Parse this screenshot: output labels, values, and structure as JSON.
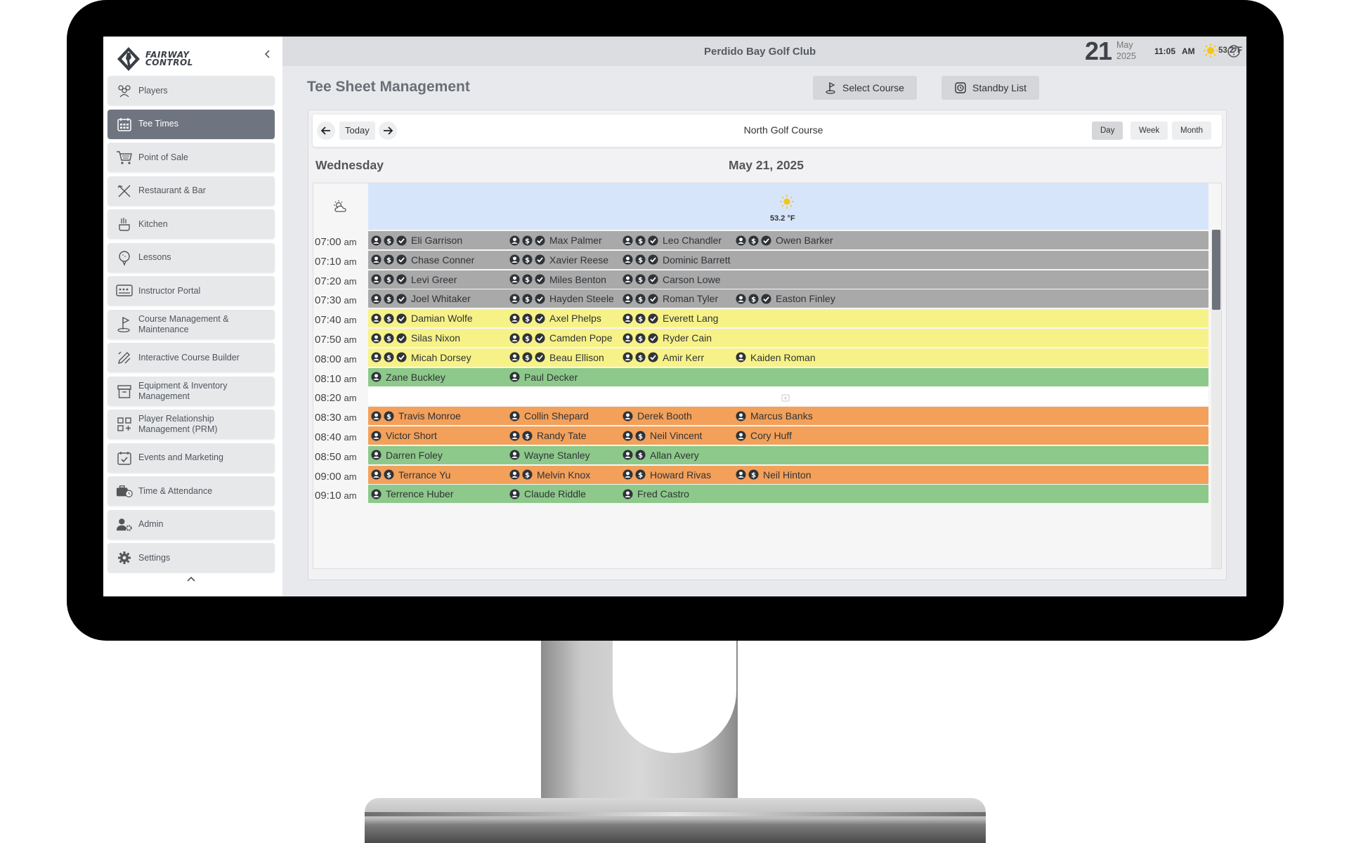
{
  "brand": {
    "logo_line1": "FAIRWAY",
    "logo_line2": "CONTROL"
  },
  "sidebar": {
    "items": [
      {
        "label": "Players",
        "icon": "players-icon",
        "active": false
      },
      {
        "label": "Tee Times",
        "icon": "calendar-grid-icon",
        "active": true
      },
      {
        "label": "Point of Sale",
        "icon": "shopping-cart-icon",
        "active": false
      },
      {
        "label": "Restaurant & Bar",
        "icon": "utensils-icon",
        "active": false
      },
      {
        "label": "Kitchen",
        "icon": "cooking-pot-icon",
        "active": false
      },
      {
        "label": "Lessons",
        "icon": "golf-ball-tee-icon",
        "active": false
      },
      {
        "label": "Instructor Portal",
        "icon": "chalkboard-icon",
        "active": false
      },
      {
        "label": "Course Management & Maintenance",
        "icon": "flag-icon",
        "active": false
      },
      {
        "label": "Interactive Course Builder",
        "icon": "pencil-ruler-icon",
        "active": false
      },
      {
        "label": "Equipment & Inventory Management",
        "icon": "archive-box-icon",
        "active": false
      },
      {
        "label": "Player Relationship Management (PRM)",
        "icon": "grid-plus-icon",
        "active": false
      },
      {
        "label": "Events and Marketing",
        "icon": "calendar-check-icon",
        "active": false
      },
      {
        "label": "Time & Attendance",
        "icon": "briefcase-clock-icon",
        "active": false
      },
      {
        "label": "Admin",
        "icon": "user-gear-icon",
        "active": false
      },
      {
        "label": "Settings",
        "icon": "gear-icon",
        "active": false
      }
    ]
  },
  "header": {
    "club_name": "Perdido Bay Golf Club",
    "day": "21",
    "month": "May",
    "year": "2025",
    "time": "11:05",
    "ampm": "AM",
    "temp": "53.2°F"
  },
  "main": {
    "title": "Tee Sheet Management",
    "select_course": "Select Course",
    "standby_list": "Standby List",
    "today": "Today",
    "course": "North Golf Course",
    "views": [
      "Day",
      "Week",
      "Month"
    ],
    "active_view": "Day",
    "weekday": "Wednesday",
    "date": "May 21, 2025",
    "weather_temp": "53.2 °F"
  },
  "tee_times": [
    {
      "time": "07:00",
      "ap": "am",
      "color": "gray",
      "players": [
        {
          "name": "Eli Garrison",
          "icons": [
            "user",
            "dollar",
            "check"
          ]
        },
        {
          "name": "Max Palmer",
          "icons": [
            "user",
            "dollar",
            "check"
          ]
        },
        {
          "name": "Leo Chandler",
          "icons": [
            "user",
            "dollar",
            "check"
          ]
        },
        {
          "name": "Owen Barker",
          "icons": [
            "user",
            "dollar",
            "check"
          ]
        }
      ]
    },
    {
      "time": "07:10",
      "ap": "am",
      "color": "gray",
      "players": [
        {
          "name": "Chase Conner",
          "icons": [
            "user",
            "dollar",
            "check"
          ]
        },
        {
          "name": "Xavier Reese",
          "icons": [
            "user",
            "dollar",
            "check"
          ]
        },
        {
          "name": "Dominic Barrett",
          "icons": [
            "user",
            "dollar",
            "check"
          ]
        }
      ]
    },
    {
      "time": "07:20",
      "ap": "am",
      "color": "gray",
      "players": [
        {
          "name": "Levi Greer",
          "icons": [
            "user",
            "dollar",
            "check"
          ]
        },
        {
          "name": "Miles Benton",
          "icons": [
            "user",
            "dollar",
            "check"
          ]
        },
        {
          "name": "Carson Lowe",
          "icons": [
            "user",
            "dollar",
            "check"
          ]
        }
      ]
    },
    {
      "time": "07:30",
      "ap": "am",
      "color": "gray",
      "players": [
        {
          "name": "Joel Whitaker",
          "icons": [
            "user",
            "dollar",
            "check"
          ]
        },
        {
          "name": "Hayden Steele",
          "icons": [
            "user",
            "dollar",
            "check"
          ]
        },
        {
          "name": "Roman Tyler",
          "icons": [
            "user",
            "dollar",
            "check"
          ]
        },
        {
          "name": "Easton Finley",
          "icons": [
            "user",
            "dollar",
            "check"
          ]
        }
      ]
    },
    {
      "time": "07:40",
      "ap": "am",
      "color": "yellow",
      "players": [
        {
          "name": "Damian Wolfe",
          "icons": [
            "user",
            "dollar",
            "check"
          ]
        },
        {
          "name": "Axel Phelps",
          "icons": [
            "user",
            "dollar",
            "check"
          ]
        },
        {
          "name": "Everett Lang",
          "icons": [
            "user",
            "dollar",
            "check"
          ]
        }
      ]
    },
    {
      "time": "07:50",
      "ap": "am",
      "color": "yellow",
      "players": [
        {
          "name": "Silas Nixon",
          "icons": [
            "user",
            "dollar",
            "check"
          ]
        },
        {
          "name": "Camden Pope",
          "icons": [
            "user",
            "dollar",
            "check"
          ]
        },
        {
          "name": "Ryder Cain",
          "icons": [
            "user",
            "dollar",
            "check"
          ]
        }
      ]
    },
    {
      "time": "08:00",
      "ap": "am",
      "color": "yellow",
      "players": [
        {
          "name": "Micah Dorsey",
          "icons": [
            "user",
            "dollar",
            "check"
          ]
        },
        {
          "name": "Beau Ellison",
          "icons": [
            "user",
            "dollar",
            "check"
          ]
        },
        {
          "name": "Amir Kerr",
          "icons": [
            "user",
            "dollar",
            "check"
          ]
        },
        {
          "name": "Kaiden Roman",
          "icons": [
            "user"
          ]
        }
      ]
    },
    {
      "time": "08:10",
      "ap": "am",
      "color": "green",
      "players": [
        {
          "name": "Zane Buckley",
          "icons": [
            "user"
          ]
        },
        {
          "name": "Paul Decker",
          "icons": [
            "user"
          ]
        }
      ]
    },
    {
      "time": "08:20",
      "ap": "am",
      "color": "empty",
      "players": []
    },
    {
      "time": "08:30",
      "ap": "am",
      "color": "orange",
      "players": [
        {
          "name": "Travis Monroe",
          "icons": [
            "user",
            "dollar"
          ]
        },
        {
          "name": "Collin Shepard",
          "icons": [
            "user"
          ]
        },
        {
          "name": "Derek Booth",
          "icons": [
            "user"
          ]
        },
        {
          "name": "Marcus Banks",
          "icons": [
            "user"
          ]
        }
      ]
    },
    {
      "time": "08:40",
      "ap": "am",
      "color": "orange",
      "players": [
        {
          "name": "Victor Short",
          "icons": [
            "user"
          ]
        },
        {
          "name": "Randy Tate",
          "icons": [
            "user",
            "dollar"
          ]
        },
        {
          "name": "Neil Vincent",
          "icons": [
            "user",
            "dollar"
          ]
        },
        {
          "name": "Cory Huff",
          "icons": [
            "user"
          ]
        }
      ]
    },
    {
      "time": "08:50",
      "ap": "am",
      "color": "green",
      "players": [
        {
          "name": "Darren Foley",
          "icons": [
            "user"
          ]
        },
        {
          "name": "Wayne Stanley",
          "icons": [
            "user"
          ]
        },
        {
          "name": "Allan Avery",
          "icons": [
            "user",
            "dollar"
          ]
        }
      ]
    },
    {
      "time": "09:00",
      "ap": "am",
      "color": "orange",
      "players": [
        {
          "name": "Terrance Yu",
          "icons": [
            "user",
            "dollar"
          ]
        },
        {
          "name": "Melvin Knox",
          "icons": [
            "user",
            "dollar"
          ]
        },
        {
          "name": "Howard Rivas",
          "icons": [
            "user",
            "dollar"
          ]
        },
        {
          "name": "Neil Hinton",
          "icons": [
            "user",
            "dollar"
          ]
        }
      ]
    },
    {
      "time": "09:10",
      "ap": "am",
      "color": "green",
      "players": [
        {
          "name": "Terrence Huber",
          "icons": [
            "user"
          ]
        },
        {
          "name": "Claude Riddle",
          "icons": [
            "user"
          ]
        },
        {
          "name": "Fred Castro",
          "icons": [
            "user"
          ]
        }
      ]
    }
  ],
  "colors": {
    "gray": "#a9a9a9",
    "yellow": "#f7f287",
    "green": "#8dc98a",
    "orange": "#f3a05a",
    "sidebar_active": "#6f7580"
  }
}
